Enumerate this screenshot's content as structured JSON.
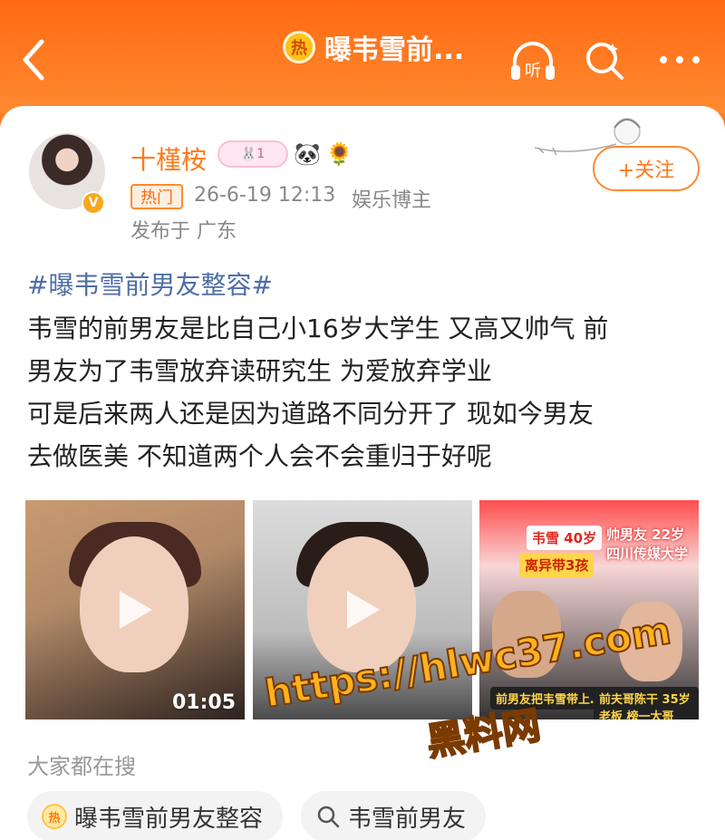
{
  "header": {
    "title": "曝韦雪前...",
    "hot_badge": "热"
  },
  "post": {
    "username": "十槿桉",
    "badge_text": "1",
    "badge_emojis": [
      "🐼",
      "🌻"
    ],
    "verified_mark": "V",
    "hot_tag": "热门",
    "timestamp": "26-6-19 12:13",
    "role": "娱乐博主",
    "location": "发布于 广东",
    "follow_label": "+关注",
    "topic": "#曝韦雪前男友整容#",
    "lines": [
      "韦雪的前男友是比自己小16岁大学生 又高又帅气 前",
      "男友为了韦雪放弃读研究生 为爱放弃学业",
      "可是后来两人还是因为道路不同分开了 现如今男友",
      "去做医美 不知道两个人会不会重归于好呢"
    ]
  },
  "media": {
    "video1_duration": "01:05",
    "thumb3_tags": [
      "韦雪 40岁",
      "帅男友 22岁 四川传媒大学",
      "离异带3孩",
      "前男友把韦雪带上…",
      "前夫哥陈干 35岁 老板 榜一大哥"
    ]
  },
  "watermark": {
    "url": "https://hlwc37.com",
    "brand": "黑料网"
  },
  "search": {
    "caption": "大家都在搜",
    "chips": [
      {
        "label": "曝韦雪前男友整容",
        "hot": "热"
      },
      {
        "label": "韦雪前男友"
      }
    ]
  },
  "colors": {
    "accent": "#ff7a22",
    "topic": "#4f6ea6",
    "username": "#ff7a1a"
  }
}
